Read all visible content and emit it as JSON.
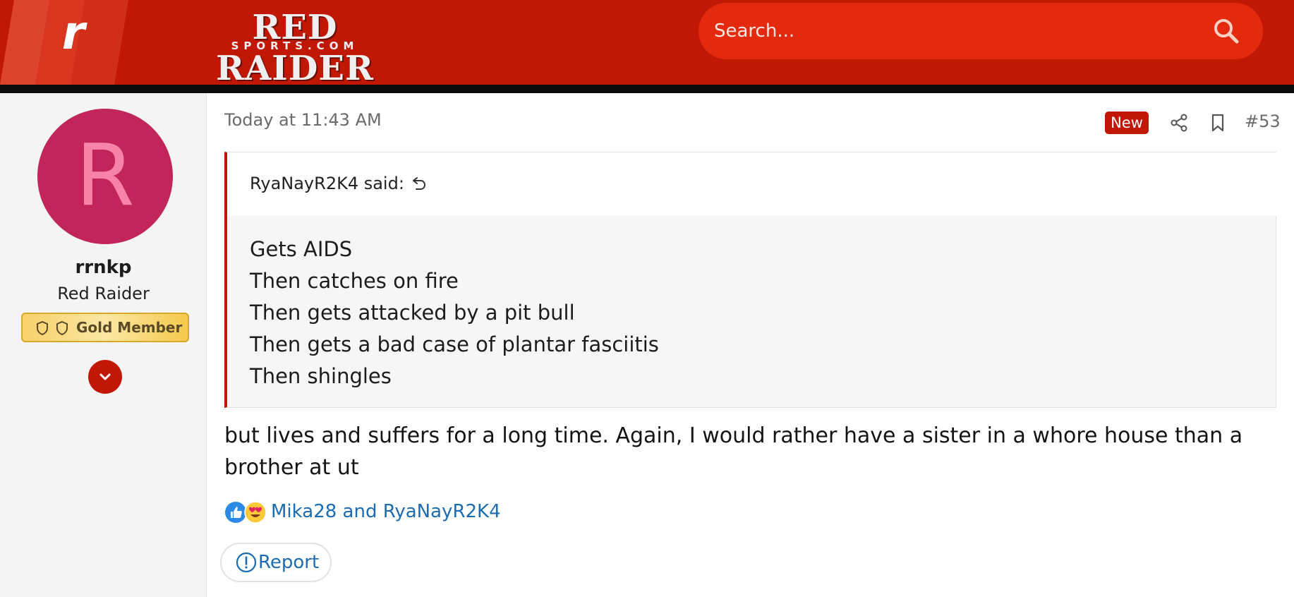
{
  "header": {
    "logo_letter": "r",
    "brand_main": "RED RAIDER",
    "brand_sub": "SPORTS.COM",
    "search_placeholder": "Search...",
    "colors": {
      "header_red": "#c01805",
      "search_red": "#e32a0e",
      "strip": "#0c0c0c"
    }
  },
  "sidebar": {
    "avatar_letter": "R",
    "username": "rrnkp",
    "user_title": "Red Raider",
    "badge_label": "Gold Member",
    "icons": [
      "shield-icon",
      "shield-icon",
      "chevron-down-icon"
    ],
    "colors": {
      "avatar_bg": "#c2255c",
      "avatar_fg": "#f784a8"
    }
  },
  "post": {
    "timestamp": "Today at 11:43 AM",
    "new_label": "New",
    "post_number": "#53",
    "icons": [
      "share-icon",
      "bookmark-icon"
    ],
    "quote": {
      "author_line": "RyaNayR2K4 said:",
      "lines": [
        "Gets AIDS",
        "Then catches on fire",
        "Then gets attacked by a pit bull",
        "Then gets a bad case of plantar fasciitis",
        "Then shingles"
      ]
    },
    "body": "but lives and suffers for a long time. Again, I would rather have a sister in a whore house than a brother at ut",
    "reactions": {
      "types": [
        "like-icon",
        "love-icon"
      ],
      "users_text": "Mika28 and RyaNayR2K4"
    },
    "report_label": "Report"
  }
}
